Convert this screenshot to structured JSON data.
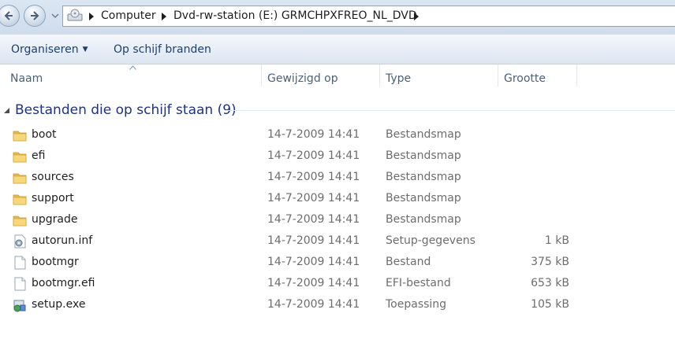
{
  "navigation": {
    "back_icon": "back-arrow-icon",
    "forward_icon": "forward-arrow-icon",
    "history_icon": "chevron-down-icon"
  },
  "address": {
    "icon": "drive-icon",
    "crumbs": [
      "Computer",
      "Dvd-rw-station (E:) GRMCHPXFREO_NL_DVD"
    ]
  },
  "toolbar": {
    "organize_label": "Organiseren",
    "burn_label": "Op schijf branden"
  },
  "columns": {
    "name": "Naam",
    "modified": "Gewijzigd op",
    "type": "Type",
    "size": "Grootte"
  },
  "group": {
    "title": "Bestanden die op schijf staan (9)"
  },
  "files": [
    {
      "name": "boot",
      "modified": "14-7-2009 14:41",
      "type": "Bestandsmap",
      "size": "",
      "icon": "folder-icon"
    },
    {
      "name": "efi",
      "modified": "14-7-2009 14:41",
      "type": "Bestandsmap",
      "size": "",
      "icon": "folder-icon"
    },
    {
      "name": "sources",
      "modified": "14-7-2009 14:41",
      "type": "Bestandsmap",
      "size": "",
      "icon": "folder-icon"
    },
    {
      "name": "support",
      "modified": "14-7-2009 14:41",
      "type": "Bestandsmap",
      "size": "",
      "icon": "folder-icon"
    },
    {
      "name": "upgrade",
      "modified": "14-7-2009 14:41",
      "type": "Bestandsmap",
      "size": "",
      "icon": "folder-icon"
    },
    {
      "name": "autorun.inf",
      "modified": "14-7-2009 14:41",
      "type": "Setup-gegevens",
      "size": "1 kB",
      "icon": "settings-file-icon"
    },
    {
      "name": "bootmgr",
      "modified": "14-7-2009 14:41",
      "type": "Bestand",
      "size": "375 kB",
      "icon": "file-icon"
    },
    {
      "name": "bootmgr.efi",
      "modified": "14-7-2009 14:41",
      "type": "EFI-bestand",
      "size": "653 kB",
      "icon": "file-icon"
    },
    {
      "name": "setup.exe",
      "modified": "14-7-2009 14:41",
      "type": "Toepassing",
      "size": "105 kB",
      "icon": "setup-exe-icon"
    }
  ],
  "colors": {
    "group_title": "#1e3287",
    "toolbar_text": "#1e3f6e",
    "folder": "#f2cf6b"
  }
}
